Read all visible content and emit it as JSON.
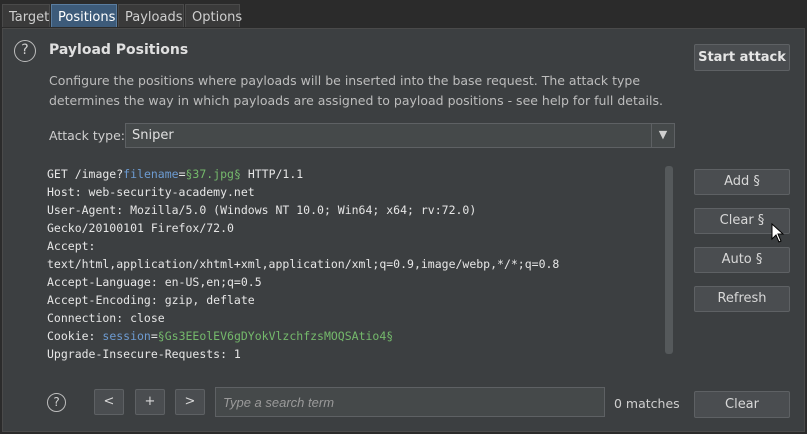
{
  "tabs": [
    {
      "label": "Target"
    },
    {
      "label": "Positions",
      "active": true
    },
    {
      "label": "Payloads"
    },
    {
      "label": "Options"
    }
  ],
  "panel": {
    "help_glyph": "?",
    "title": "Payload Positions",
    "description": "Configure the positions where payloads will be inserted into the base request. The attack type determines the way in which payloads are assigned to payload positions - see help for full details.",
    "start_attack_label": "Start attack",
    "attack_type_label": "Attack type:",
    "attack_type_value": "Sniper",
    "dropdown_arrow": "▼"
  },
  "request": {
    "lines": [
      [
        {
          "t": "GET /image?"
        },
        {
          "t": "filename",
          "c": "key"
        },
        {
          "t": "="
        },
        {
          "t": "§37.jpg§",
          "c": "payload"
        },
        {
          "t": " HTTP/1.1"
        }
      ],
      [
        {
          "t": "Host: web-security-academy.net"
        }
      ],
      [
        {
          "t": "User-Agent: Mozilla/5.0 (Windows NT 10.0; Win64; x64; rv:72.0)"
        }
      ],
      [
        {
          "t": "Gecko/20100101 Firefox/72.0"
        }
      ],
      [
        {
          "t": "Accept:"
        }
      ],
      [
        {
          "t": "text/html,application/xhtml+xml,application/xml;q=0.9,image/webp,*/*;q=0.8"
        }
      ],
      [
        {
          "t": "Accept-Language: en-US,en;q=0.5"
        }
      ],
      [
        {
          "t": "Accept-Encoding: gzip, deflate"
        }
      ],
      [
        {
          "t": "Connection: close"
        }
      ],
      [
        {
          "t": "Cookie: "
        },
        {
          "t": "session",
          "c": "key"
        },
        {
          "t": "="
        },
        {
          "t": "§Gs3EEolEV6gDYokVlzchfzsMOQSAtio4§",
          "c": "payload"
        }
      ],
      [
        {
          "t": "Upgrade-Insecure-Requests: 1"
        }
      ]
    ]
  },
  "side_buttons": {
    "add": "Add §",
    "clear": "Clear §",
    "auto": "Auto §",
    "refresh": "Refresh"
  },
  "search_bar": {
    "help_glyph": "?",
    "prev": "<",
    "add": "+",
    "next": ">",
    "placeholder": "Type a search term",
    "matches": "0 matches",
    "clear": "Clear"
  },
  "colors": {
    "key": "#6d9bd1",
    "payload": "#74b96b",
    "tab_active": "#3d5b7a",
    "panel_bg": "#3c3f41"
  }
}
